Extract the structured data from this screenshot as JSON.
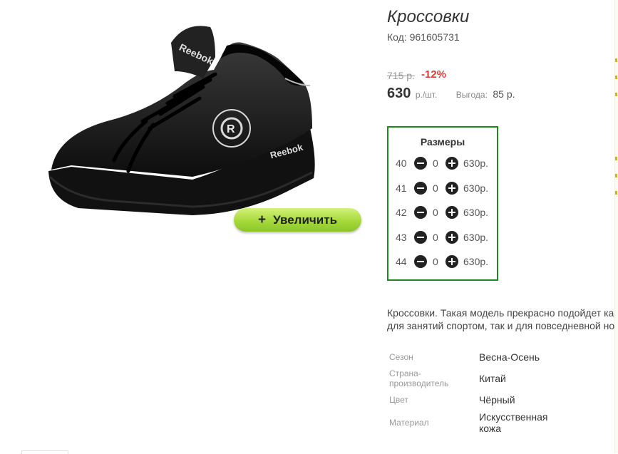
{
  "product": {
    "title": "Кроссовки",
    "code": "Код: 961605731",
    "old_price": "715 р.",
    "discount": "-12%",
    "price": "630",
    "price_unit": "р./шт.",
    "savings_label": "Выгода:",
    "savings_value": "85 р.",
    "zoom_button": "Увеличить",
    "image_icon": "sneaker-image",
    "description_line1": "Кроссовки. Такая модель прекрасно подойдет ка",
    "description_line2": "для занятий спортом, так и для повседневной но"
  },
  "sizes": {
    "title": "Размеры",
    "rows": [
      {
        "size": "40",
        "qty": "0",
        "price": "630р."
      },
      {
        "size": "41",
        "qty": "0",
        "price": "630р."
      },
      {
        "size": "42",
        "qty": "0",
        "price": "630р."
      },
      {
        "size": "43",
        "qty": "0",
        "price": "630р."
      },
      {
        "size": "44",
        "qty": "0",
        "price": "630р."
      }
    ]
  },
  "specs": [
    {
      "label": "Сезон",
      "value": "Весна-Осень"
    },
    {
      "label": "Страна-\nпроизводитель",
      "value": "Китай"
    },
    {
      "label": "Цвет",
      "value": "Чёрный"
    },
    {
      "label": "Материал",
      "value": "Искусственная\nкожа"
    }
  ],
  "colors": {
    "accent_green": "#1e8a1e",
    "discount_red": "#e23a3a",
    "button_green": "#a6d93a"
  }
}
